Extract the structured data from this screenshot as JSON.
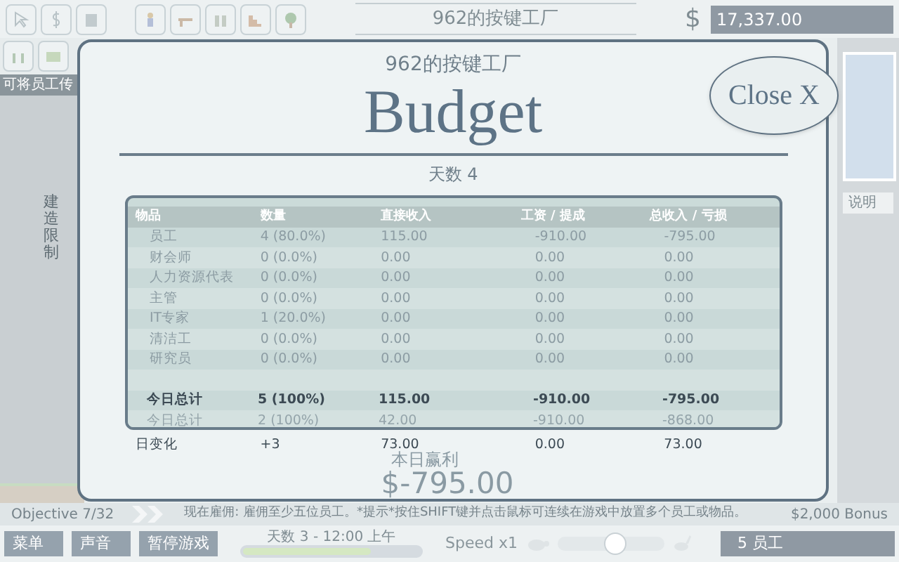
{
  "top_bar": {
    "company": "962的按键工厂",
    "currency": "$",
    "money": "17,337.00"
  },
  "sidebar": {
    "header": "可将员工传",
    "vertical_label": "建造限制"
  },
  "right_panel": {
    "help_button": "说明"
  },
  "budget": {
    "company": "962的按键工厂",
    "title": "Budget",
    "day": "天数 4",
    "close": "Close X",
    "columns": [
      "物品",
      "数量",
      "直接收入",
      "工资 / 提成",
      "总收入 / 亏损"
    ],
    "rows": [
      {
        "kind": "item",
        "cells": [
          "员工",
          "4 (80.0%)",
          "115.00",
          "-910.00",
          "-795.00"
        ]
      },
      {
        "kind": "item",
        "cells": [
          "财会师",
          "0 (0.0%)",
          "0.00",
          "0.00",
          "0.00"
        ]
      },
      {
        "kind": "item",
        "cells": [
          "人力资源代表",
          "0 (0.0%)",
          "0.00",
          "0.00",
          "0.00"
        ]
      },
      {
        "kind": "item",
        "cells": [
          "主管",
          "0 (0.0%)",
          "0.00",
          "0.00",
          "0.00"
        ]
      },
      {
        "kind": "item",
        "cells": [
          "IT专家",
          "1 (20.0%)",
          "0.00",
          "0.00",
          "0.00"
        ]
      },
      {
        "kind": "item",
        "cells": [
          "清洁工",
          "0 (0.0%)",
          "0.00",
          "0.00",
          "0.00"
        ]
      },
      {
        "kind": "item",
        "cells": [
          "研究员",
          "0 (0.0%)",
          "0.00",
          "0.00",
          "0.00"
        ]
      },
      {
        "kind": "blank",
        "cells": []
      },
      {
        "kind": "total",
        "cells": [
          "今日总计",
          "5 (100%)",
          "115.00",
          "-910.00",
          "-795.00"
        ]
      },
      {
        "kind": "previous",
        "cells": [
          "今日总计",
          "2 (100%)",
          "42.00",
          "-910.00",
          "-868.00"
        ]
      }
    ],
    "change_row": [
      "日变化",
      "+3",
      "73.00",
      "0.00",
      "73.00"
    ],
    "profit_label": "本日赢利",
    "profit": "$-795.00"
  },
  "objective_bar": {
    "objective": "Objective 7/32",
    "message": "现在雇佣: 雇佣至少五位员工。*提示*按住SHIFT键并点击鼠标可连续在游戏中放置多个员工或物品。",
    "bonus": "$2,000 Bonus"
  },
  "controls": {
    "buttons": [
      "菜单",
      "声音",
      "暂停游戏"
    ],
    "time": "天数 3 - 12:00 上午",
    "day_progress": {
      "level": 0.72
    },
    "speed_label": "Speed x1",
    "speed": {
      "level": 0.55
    },
    "employees": "5 员工"
  }
}
